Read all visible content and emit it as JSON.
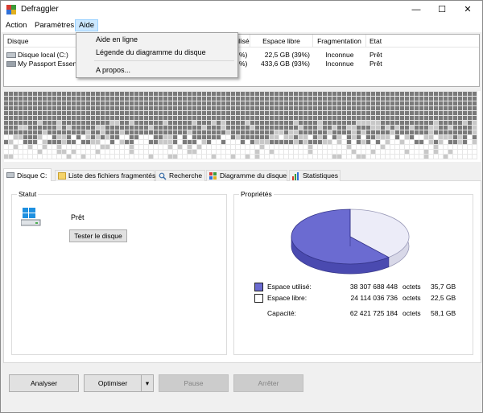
{
  "window": {
    "title": "Defraggler"
  },
  "titlebar_buttons": {
    "minimize": "—",
    "maximize": "☐",
    "close": "✕"
  },
  "menu": {
    "action": "Action",
    "parametres": "Paramètres",
    "aide": "Aide"
  },
  "help_menu": {
    "items": [
      "Aide en ligne",
      "Légende du diagramme du disque",
      "A propos..."
    ]
  },
  "drive_list": {
    "columns": [
      "Disque",
      "ilisé",
      "Espace libre",
      "Fragmentation",
      "Etat"
    ],
    "rows": [
      {
        "disk": "Disque local (C:)",
        "used": "%)",
        "free": "22,5 GB (39%)",
        "frag": "Inconnue",
        "state": "Prêt"
      },
      {
        "disk": "My Passport Essenti",
        "used": "%)",
        "free": "433,6 GB (93%)",
        "frag": "Inconnue",
        "state": "Prêt"
      }
    ]
  },
  "tabs": [
    "Disque C:",
    "Liste des fichiers fragmentés",
    "Recherche",
    "Diagramme du disque",
    "Statistiques"
  ],
  "status": {
    "title": "Statut",
    "state": "Prêt",
    "test_button": "Tester le disque"
  },
  "properties": {
    "title": "Propriétés",
    "used_label": "Espace utilisé:",
    "used_bytes": "38 307 688 448",
    "used_unit": "octets",
    "used_size": "35,7 GB",
    "free_label": "Espace libre:",
    "free_bytes": "24 114 036 736",
    "free_unit": "octets",
    "free_size": "22,5 GB",
    "capacity_label": "Capacité:",
    "capacity_bytes": "62 421 725 184",
    "capacity_unit": "octets",
    "capacity_size": "58,1 GB",
    "used_fraction": 0.614,
    "used_color": "#6b6bd1",
    "free_color": "#ececf8"
  },
  "buttons": {
    "analyse": "Analyser",
    "optimise": "Optimiser",
    "optimise_arrow": "▾",
    "pause": "Pause",
    "stop": "Arrêter"
  },
  "disk_map_colors": {
    "used": "#7a7a7a",
    "light": "#c8c8c8",
    "free": "#ffffff"
  }
}
